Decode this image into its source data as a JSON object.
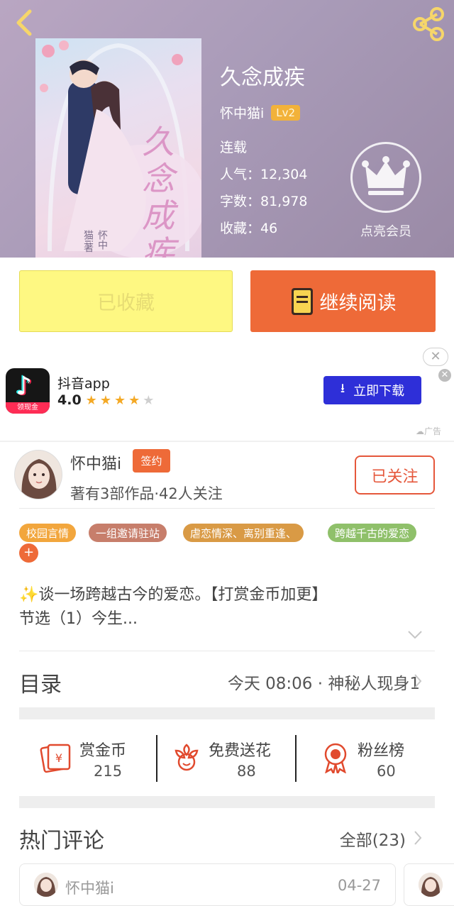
{
  "book": {
    "title": "久念成疾",
    "author": "怀中猫i",
    "level": "Lv2",
    "status": "连载",
    "popularity": "人气：12,304",
    "words": "字数：81,978",
    "favorites": "收藏：46",
    "cover_title": "久念成疾",
    "cover_author": "怀中猫i著"
  },
  "vip": {
    "label": "点亮会员"
  },
  "actions": {
    "collected_label": "已收藏",
    "read_label": "继续阅读"
  },
  "ad": {
    "app_name": "抖音app",
    "rating": "4.0",
    "stars_filled": 4,
    "stars_total": 5,
    "icon_badge": "领现金",
    "download_label": "立即下载",
    "ad_label": "广告"
  },
  "author_card": {
    "name": "怀中猫i",
    "badge": "签约",
    "stats": "著有3部作品·42人关注",
    "follow_label": "已关注"
  },
  "tags": [
    {
      "label": "校园言情",
      "color": "#f2a63d"
    },
    {
      "label": "一组邀请驻站",
      "color": "#c77e6b"
    },
    {
      "label": "虐恋情深、离别重逢、",
      "color": "#d99a45"
    },
    {
      "label": "跨越千古的爱恋",
      "color": "#8fc06a"
    }
  ],
  "intro": {
    "line1": "谈一场跨越古今的爱恋。【打赏金币加更】",
    "line2": "节选（1）今生..."
  },
  "catalog": {
    "title": "目录",
    "latest": "今天 08:06 · 神秘人现身1"
  },
  "stats": [
    {
      "label": "赏金币",
      "value": "215",
      "icon": "coin-envelope-icon"
    },
    {
      "label": "免费送花",
      "value": "88",
      "icon": "flower-icon"
    },
    {
      "label": "粉丝榜",
      "value": "60",
      "icon": "medal-icon"
    }
  ],
  "comments": {
    "title": "热门评论",
    "all": "全部(23)",
    "first": {
      "name": "怀中猫i",
      "date": "04-27"
    }
  },
  "colors": {
    "accent": "#ee6a38",
    "collected_bg": "#fef882",
    "ad_button": "#2e2fd8",
    "header": "#a99bb8"
  }
}
